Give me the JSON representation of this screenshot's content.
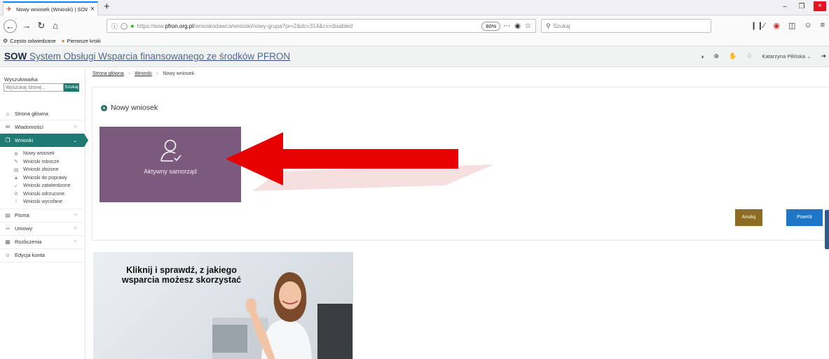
{
  "browser": {
    "tab_title": "Nowy wniosek (Wnioski) | SOW",
    "new_tab": "+",
    "url_prefix": "https://sow.",
    "url_domain": "pfron.org.pl",
    "url_path": "/wnioskodawca/wnioski/nowy-grupa?pr=2&dc=314&cx=disabled",
    "zoom": "80%",
    "search_placeholder": "Szukaj",
    "bookmarks": [
      "Często odwiedzane",
      "Pierwsze kroki"
    ]
  },
  "app": {
    "title_bold": "SOW",
    "title_rest": " System Obsługi Wsparcia finansowanego ze środków PFRON",
    "user_name": "Katarzyna Pilińska"
  },
  "sidebar": {
    "search_label": "Wyszukiwarka",
    "search_placeholder": "Wyszukaj stronę...",
    "search_button": "Szukaj",
    "items": [
      {
        "label": "Strona główna",
        "icon": "home-icon"
      },
      {
        "label": "Wiadomości",
        "icon": "mail-icon"
      },
      {
        "label": "Wnioski",
        "icon": "documents-icon"
      },
      {
        "label": "Pisma",
        "icon": "letters-icon"
      },
      {
        "label": "Umowy",
        "icon": "handshake-icon"
      },
      {
        "label": "Rozliczenia",
        "icon": "calculator-icon"
      },
      {
        "label": "Edycja konta",
        "icon": "user-icon"
      }
    ],
    "submenu": [
      "Nowy wniosek",
      "Wnioski robocze",
      "Wnioski złożone",
      "Wnioski do poprawy",
      "Wnioski zatwierdzone",
      "Wnioski odrzucone",
      "Wnioski wycofane"
    ]
  },
  "breadcrumb": {
    "home": "Strona główna",
    "section": "Wnioski",
    "current": "Nowy wniosek"
  },
  "main": {
    "panel_title": "Nowy wniosek",
    "tile_label": "Aktywny samorząd",
    "cancel_label": "Anuluj",
    "back_label": "Powrót"
  },
  "banner": {
    "text": "Kliknij i sprawdź, z jakiego wsparcia możesz skorzystać"
  },
  "colors": {
    "sidebar_active": "#1f7a74",
    "tile": "#7b5a7d",
    "cancel": "#8c6d22",
    "back": "#1e76c7",
    "arrow": "#e60000"
  }
}
